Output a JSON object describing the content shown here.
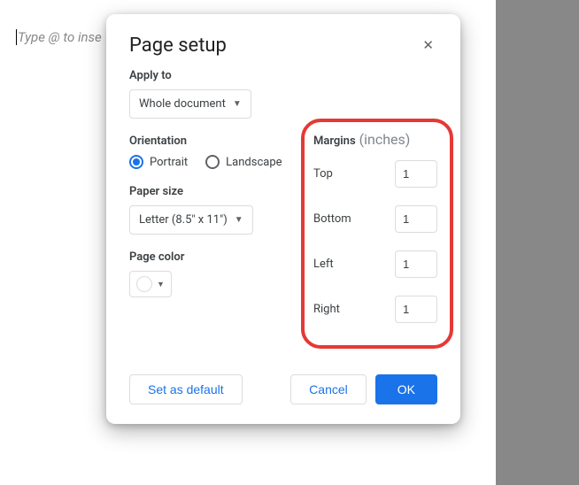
{
  "doc": {
    "placeholder": "Type @ to inse"
  },
  "dialog": {
    "title": "Page setup",
    "applyTo": {
      "label": "Apply to",
      "value": "Whole document"
    },
    "orientation": {
      "label": "Orientation",
      "portrait": "Portrait",
      "landscape": "Landscape",
      "selected": "portrait"
    },
    "paperSize": {
      "label": "Paper size",
      "value": "Letter (8.5\" x 11\")"
    },
    "pageColor": {
      "label": "Page color",
      "value": "#ffffff"
    },
    "margins": {
      "label": "Margins",
      "unit": "(inches)",
      "top": {
        "label": "Top",
        "value": "1"
      },
      "bottom": {
        "label": "Bottom",
        "value": "1"
      },
      "left": {
        "label": "Left",
        "value": "1"
      },
      "right": {
        "label": "Right",
        "value": "1"
      }
    },
    "buttons": {
      "setDefault": "Set as default",
      "cancel": "Cancel",
      "ok": "OK"
    }
  }
}
